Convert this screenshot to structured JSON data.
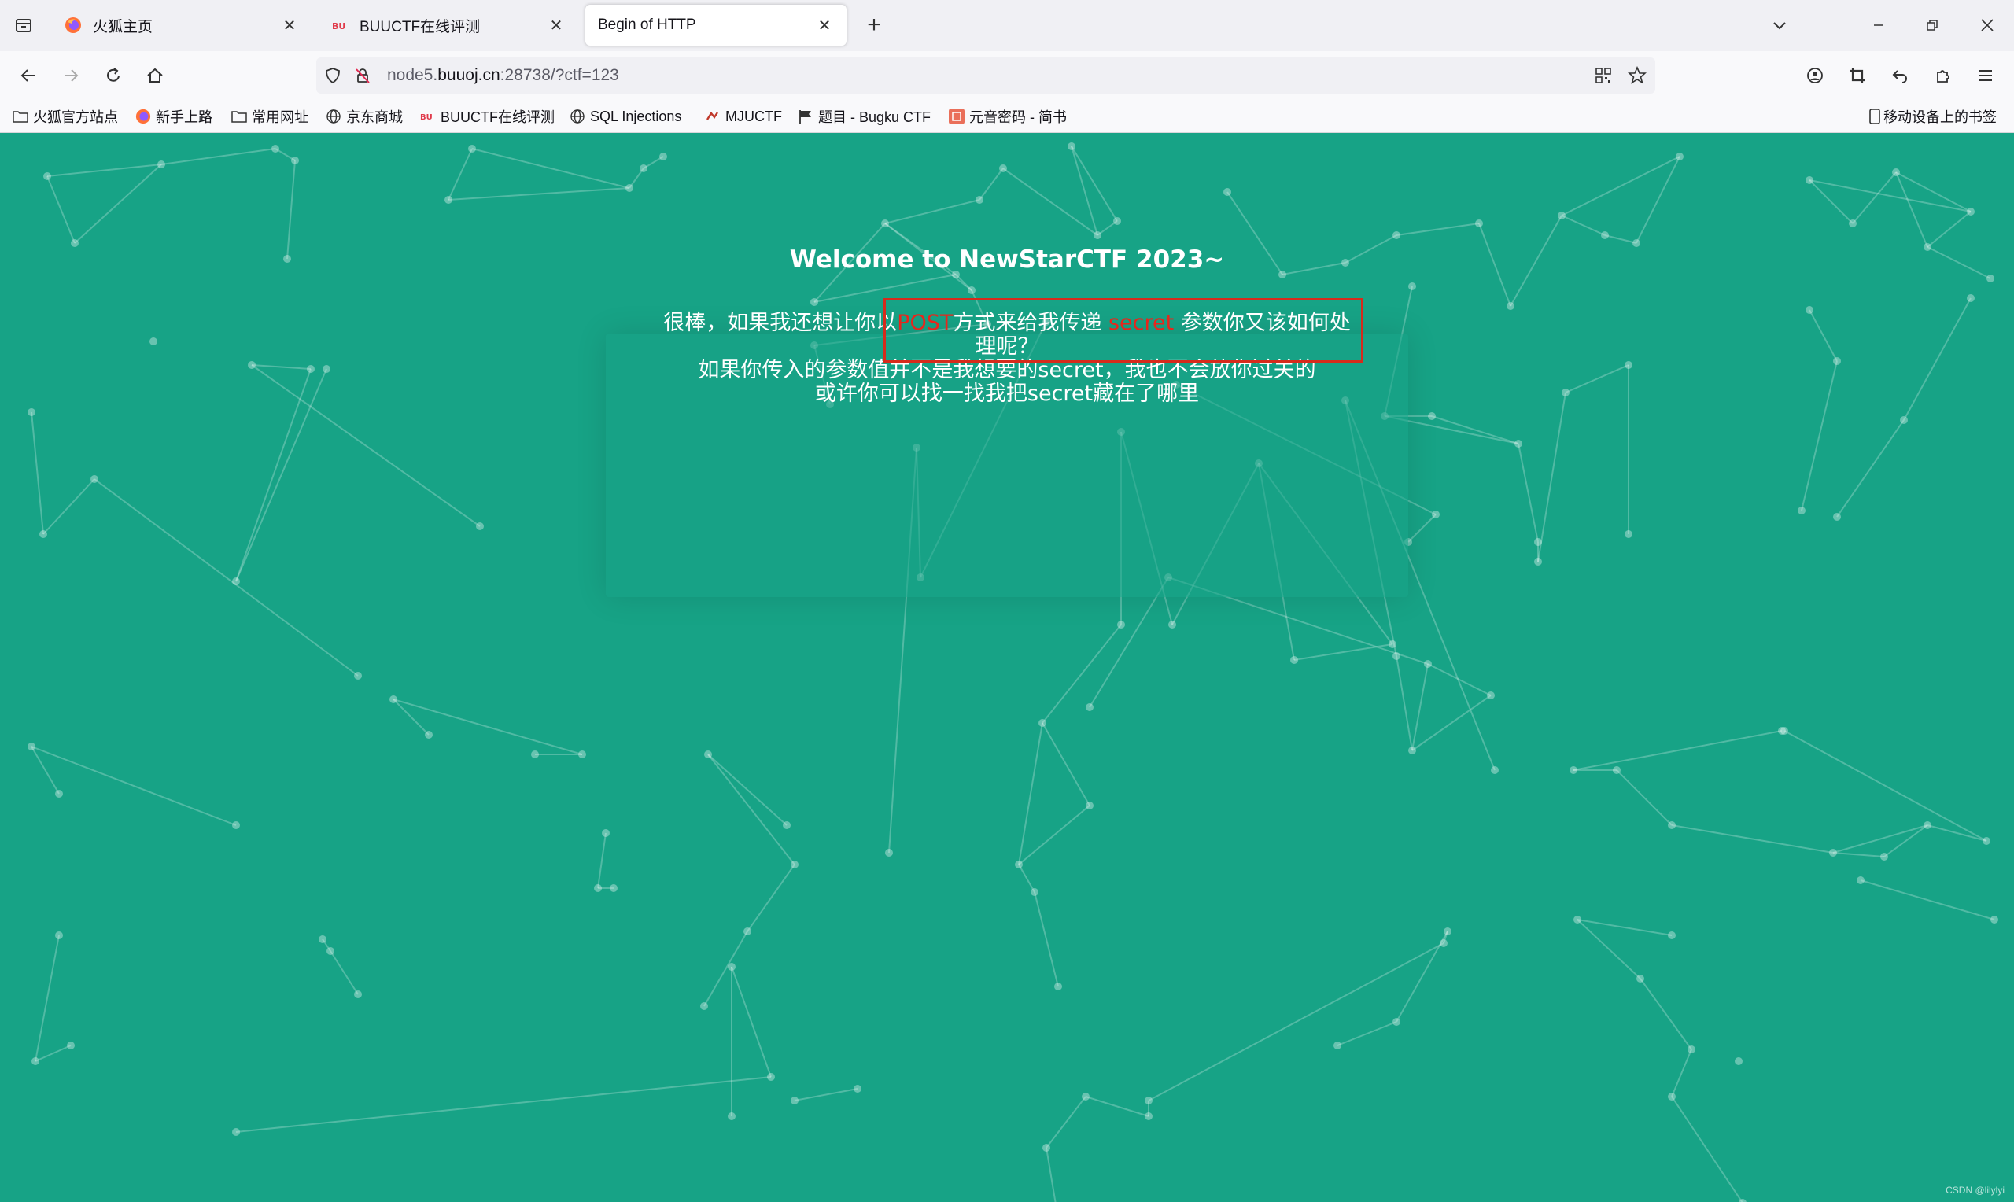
{
  "browser": {
    "tabs": [
      {
        "title": "火狐主页",
        "favicon": "firefox-icon",
        "active": false
      },
      {
        "title": "BUUCTF在线评测",
        "favicon": "buuctf-icon",
        "active": false
      },
      {
        "title": "Begin of HTTP",
        "favicon": "none",
        "active": true
      }
    ],
    "url": {
      "prefix": "node5.",
      "host": "buuoj.cn",
      "suffix": ":28738/?ctf=123"
    },
    "bookmarks": [
      {
        "label": "火狐官方站点",
        "icon": "folder-icon"
      },
      {
        "label": "新手上路",
        "icon": "firefox-icon"
      },
      {
        "label": "常用网址",
        "icon": "folder-icon"
      },
      {
        "label": "京东商城",
        "icon": "globe-icon"
      },
      {
        "label": "BUUCTF在线评测",
        "icon": "buuctf-icon"
      },
      {
        "label": "SQL Injections",
        "icon": "globe-icon"
      },
      {
        "label": "MJUCTF",
        "icon": "mj-icon"
      },
      {
        "label": "题目 - Bugku CTF",
        "icon": "flag-icon"
      },
      {
        "label": "元音密码 - 简书",
        "icon": "jianshu-icon"
      }
    ],
    "mobile_bookmarks": "移动设备上的书签"
  },
  "page": {
    "background": "#17a386",
    "title": "Welcome to NewStarCTF 2023~",
    "line1_part1": "很棒，如果我还想让你以",
    "line1_post": "POST",
    "line1_part2": "方式来给我传递 ",
    "line1_secret": "secret",
    "line1_part3": " 参数你又该如何处理呢？",
    "line2": "如果你传入的参数值并不是我想要的secret，我也不会放你过关的",
    "line3": "或许你可以找一找我把secret藏在了哪里",
    "highlight_color": "#e8261c",
    "watermark": "CSDN @lilylyi"
  }
}
